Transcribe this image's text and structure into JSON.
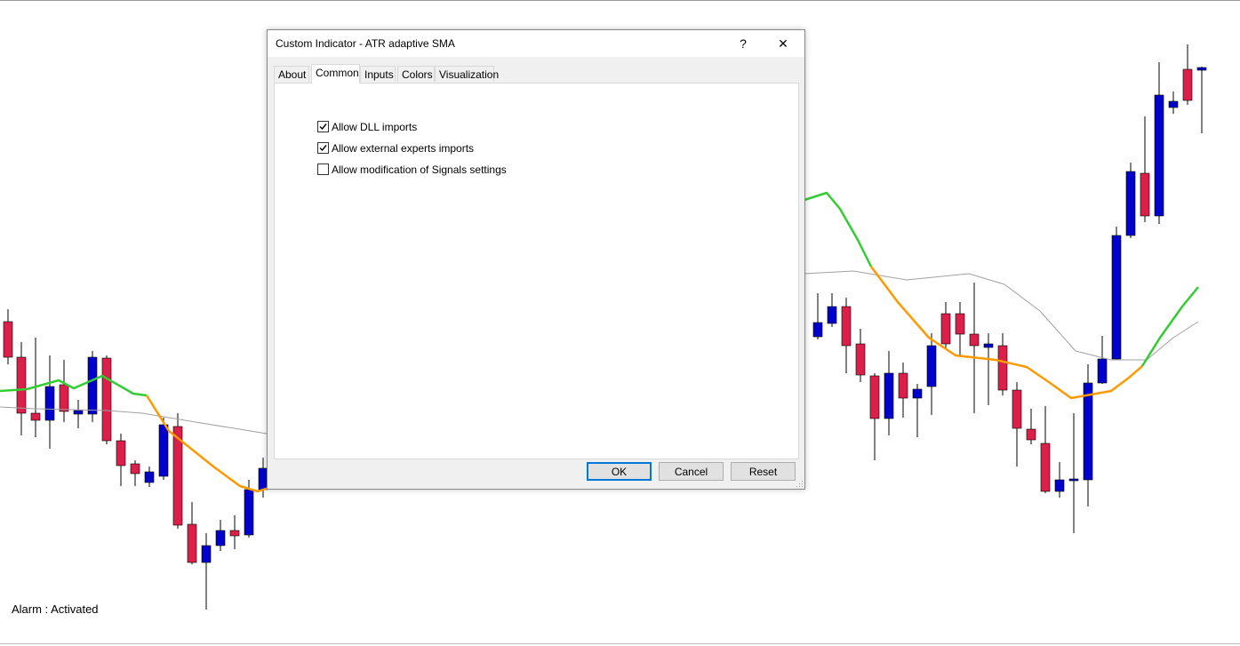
{
  "status": {
    "alarm_text": "Alarm : Activated"
  },
  "dialog": {
    "title": "Custom Indicator - ATR adaptive SMA",
    "help_glyph": "?",
    "close_glyph": "✕",
    "tabs": [
      "About",
      "Common",
      "Inputs",
      "Colors",
      "Visualization"
    ],
    "active_tab": "Common",
    "checkboxes": [
      {
        "label": "Allow DLL imports",
        "checked": true
      },
      {
        "label": "Allow external experts imports",
        "checked": true
      },
      {
        "label": "Allow modification of Signals settings",
        "checked": false
      }
    ],
    "buttons": {
      "ok": "OK",
      "cancel": "Cancel",
      "reset": "Reset"
    }
  },
  "colors": {
    "bull_candle": "#0000cc",
    "bear_candle": "#d91f4a",
    "ma_up": "#33cc33",
    "ma_down": "#ff9900",
    "envelope": "#a0a0a0",
    "accent": "#0078d7"
  }
}
